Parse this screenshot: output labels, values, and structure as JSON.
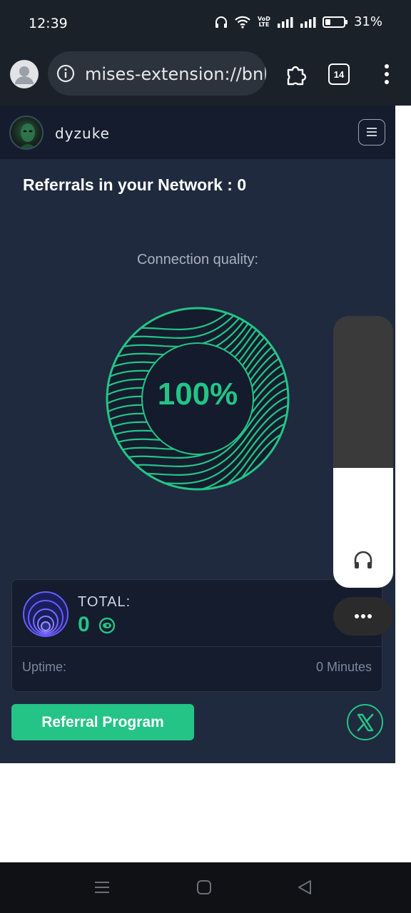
{
  "status_bar": {
    "time": "12:39",
    "network_label": "VoD LTE",
    "battery_percent": "31%",
    "battery_level": 0.31,
    "icons": [
      "headphones-icon",
      "wifi-icon",
      "volte-icon",
      "signal-icon",
      "signal-icon",
      "battery-icon"
    ]
  },
  "browser": {
    "url": "mises-extension://bnl",
    "tab_count": "14",
    "icons": [
      "profile-avatar-icon",
      "info-icon",
      "puzzle-extension-icon",
      "more-vert-icon"
    ]
  },
  "popup": {
    "username": "dyzuke",
    "referrals_title": "Referrals in your Network : 0",
    "connection_label": "Connection quality:",
    "connection_value": "100%",
    "total_label": "TOTAL:",
    "total_value": "0",
    "uptime_label": "Uptime:",
    "uptime_value": "0 Minutes",
    "referral_button": "Referral Program",
    "icons": [
      "hamburger-menu-icon",
      "coin-icon",
      "eye-icon",
      "x-logo-icon"
    ]
  },
  "volume_overlay": {
    "level": 0.44,
    "icons": [
      "headphones-icon",
      "more-horiz-icon"
    ]
  },
  "colors": {
    "accent": "#23c486",
    "popup_bg": "#1f2a3e",
    "header_bg": "#141c2d",
    "browser_bg": "#1b2129"
  },
  "nav_bar": {
    "icons": [
      "recent-apps-icon",
      "home-icon",
      "back-icon"
    ]
  }
}
